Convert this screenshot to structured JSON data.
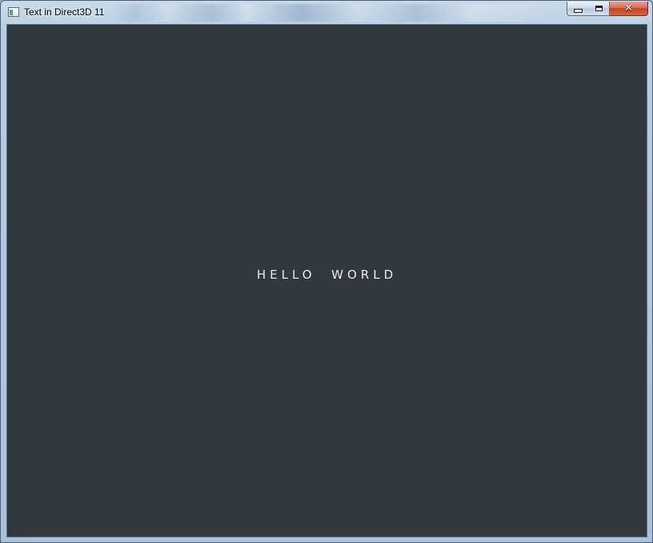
{
  "window": {
    "title": "Text in Direct3D 11",
    "app_icon": "window-app-icon"
  },
  "caption_buttons": {
    "minimize_icon": "minimize-icon",
    "maximize_icon": "maximize-icon",
    "close_icon": "close-icon",
    "close_glyph": "✕",
    "close_color": "#c9452d"
  },
  "canvas": {
    "background_color": "#33383c",
    "text": "HELLO  WORLD",
    "text_color": "#e8ecef"
  }
}
